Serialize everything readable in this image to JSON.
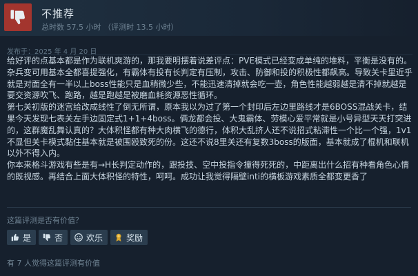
{
  "header": {
    "verdict": "不推荐",
    "hours": "总时数 57.5 小时 （评测时 13.5 小时）"
  },
  "review": {
    "posted": "发布于：2025 年 4 月 20 日",
    "paragraphs": [
      "给好评的点基本都是作为联机爽游的，那我要明摆着说差评点：PVE模式已经变成单纯的堆料，平衡是没有的。杂兵变可用基本全都喜提强化，有霸体有投有长判定有压制，攻击、防御和投的积极性都飙高。导致关卡里近乎就是对面全有一半以上boss性能只是血稍微少些，不能迅速清掉就会吃一壶，角色性能越弱越是清不掉就越是要交资源吹飞、跑路，越是跑越是被磨血耗资源恶性循环。",
      "第七关初版的迷宫给改成线性了倒无所谓，原本我以为过了第一个封印后左边里路线才是6BOSS混战关卡，结果今天发现七表关左手边固定式1+1+4boss。俩龙都会投、大鬼霸体、劳模心爱平常就是小号异型天天打突进的，这群魔乱舞认真的？大体积怪都有种大肉横飞的德行，体积大乱挤人还不说招式粘滞性一个比一个强，1v1不显但关卡模式黏住基本就是被围殴致死的份。这还不说8里关还有复数3boss的版面，基本就成了棍机和联机以外不得入内。",
      "你本来格斗游戏有些是有→H长判定动作的，跟投技、空中投指令撞得死死的，中距离出什么招有种看角色心情的既视感。再结合上面大体积怪的特性，呵呵。成功让我觉得隔壁inti的横板游戏素质全都变更香了"
    ]
  },
  "feedback": {
    "question": "这篇评测是否有价值？",
    "yes": "是",
    "no": "否",
    "funny": "欢乐",
    "award": "奖励",
    "helpful_count": "有 7 人觉得这篇评测有价值"
  },
  "colors": {
    "thumb_down_bg": "#a3352e",
    "page_bg": "#16202d",
    "button_bg": "#2b3d4e",
    "award_icon": "#d9a62e"
  },
  "icons": {
    "verdict": "thumbs-down-icon",
    "yes": "thumbs-up-icon",
    "no": "thumbs-down-icon",
    "funny": "smiley-icon",
    "award": "award-ribbon-icon"
  }
}
